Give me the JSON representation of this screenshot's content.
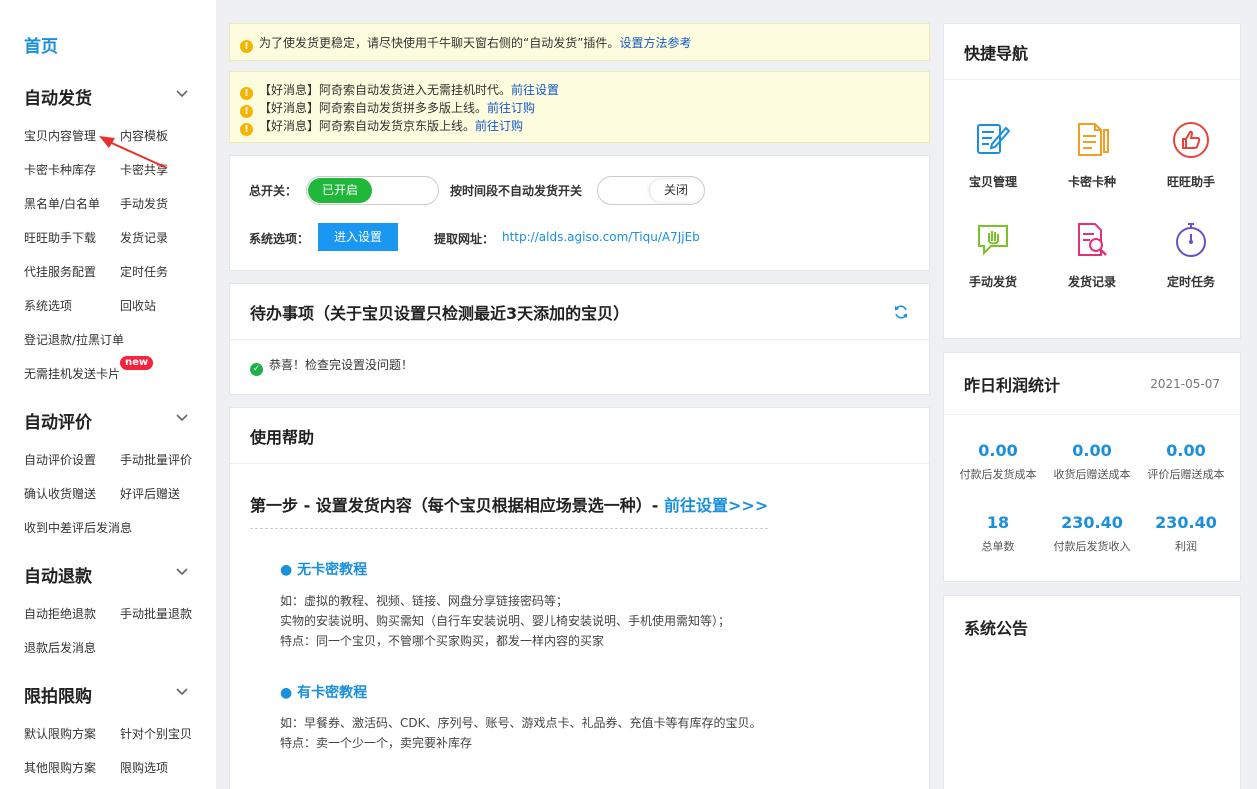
{
  "sidebar": {
    "home": "首页",
    "sections": [
      {
        "title": "自动发货",
        "items": [
          "宝贝内容管理",
          "内容模板",
          "卡密卡种库存",
          "卡密共享",
          "黑名单/白名单",
          "手动发货",
          "旺旺助手下载",
          "发货记录",
          "代挂服务配置",
          "定时任务",
          "系统选项",
          "回收站",
          "登记退款/拉黑订单",
          "无需挂机发送卡片"
        ]
      },
      {
        "title": "自动评价",
        "items": [
          "自动评价设置",
          "手动批量评价",
          "确认收货赠送",
          "好评后赠送",
          "收到中差评后发消息"
        ]
      },
      {
        "title": "自动退款",
        "items": [
          "自动拒绝退款",
          "手动批量退款",
          "退款后发消息"
        ]
      },
      {
        "title": "限拍限购",
        "items": [
          "默认限购方案",
          "针对个别宝贝",
          "其他限购方案",
          "限购选项"
        ]
      }
    ],
    "badge": "new"
  },
  "notice1": {
    "text": "为了使发货更稳定，请尽快使用千牛聊天窗右侧的“自动发货”插件。",
    "link": "设置方法参考"
  },
  "notice2": [
    {
      "text": "【好消息】阿奇索自动发货进入无需挂机时代。",
      "link": "前往设置"
    },
    {
      "text": "【好消息】阿奇索自动发货拼多多版上线。",
      "link": "前往订购"
    },
    {
      "text": "【好消息】阿奇索自动发货京东版上线。",
      "link": "前往订购"
    }
  ],
  "settings": {
    "master_label": "总开关：",
    "master_state": "已开启",
    "schedule_label": "按时间段不自动发货开关",
    "schedule_state": "关闭",
    "options_label": "系统选项：",
    "options_button": "进入设置",
    "url_label": "提取网址：",
    "url": "http://alds.agiso.com/Tiqu/A7JjEb"
  },
  "todo": {
    "title": "待办事项（关于宝贝设置只检测最近3天添加的宝贝）",
    "message": "恭喜！检查完设置没问题！"
  },
  "help": {
    "title": "使用帮助",
    "step1": "第一步 - 设置发货内容（每个宝贝根据相应场景选一种）-",
    "step1_link": "前往设置>>>",
    "tut1": {
      "title": "● 无卡密教程",
      "lines": [
        "如：虚拟的教程、视频、链接、网盘分享链接密码等；",
        "实物的安装说明、购买需知（自行车安装说明、婴儿椅安装说明、手机使用需知等）；",
        "特点：同一个宝贝，不管哪个买家购买，都发一样内容的买家"
      ]
    },
    "tut2": {
      "title": "● 有卡密教程",
      "lines": [
        "如：早餐券、激活码、CDK、序列号、账号、游戏点卡、礼品券、充值卡等有库存的宝贝。",
        "特点：卖一个少一个，卖完要补库存"
      ]
    }
  },
  "quicknav": {
    "title": "快捷导航",
    "items": [
      {
        "label": "宝贝管理",
        "icon": "edit-document-icon",
        "color": "#1a8fdc"
      },
      {
        "label": "卡密卡种",
        "icon": "card-document-icon",
        "color": "#f0a020"
      },
      {
        "label": "旺旺助手",
        "icon": "thumbs-up-icon",
        "color": "#e8443a"
      },
      {
        "label": "手动发货",
        "icon": "hand-bubble-icon",
        "color": "#7cc22a"
      },
      {
        "label": "发货记录",
        "icon": "search-document-icon",
        "color": "#e0327a"
      },
      {
        "label": "定时任务",
        "icon": "stopwatch-icon",
        "color": "#6a50c8"
      }
    ]
  },
  "profit": {
    "title": "昨日利润统计",
    "date": "2021-05-07",
    "stats": [
      {
        "value": "0.00",
        "label": "付款后发货成本"
      },
      {
        "value": "0.00",
        "label": "收货后赠送成本"
      },
      {
        "value": "0.00",
        "label": "评价后赠送成本"
      },
      {
        "value": "18",
        "label": "总单数"
      },
      {
        "value": "230.40",
        "label": "付款后发货收入"
      },
      {
        "value": "230.40",
        "label": "利润"
      }
    ]
  },
  "announcement": {
    "title": "系统公告"
  }
}
